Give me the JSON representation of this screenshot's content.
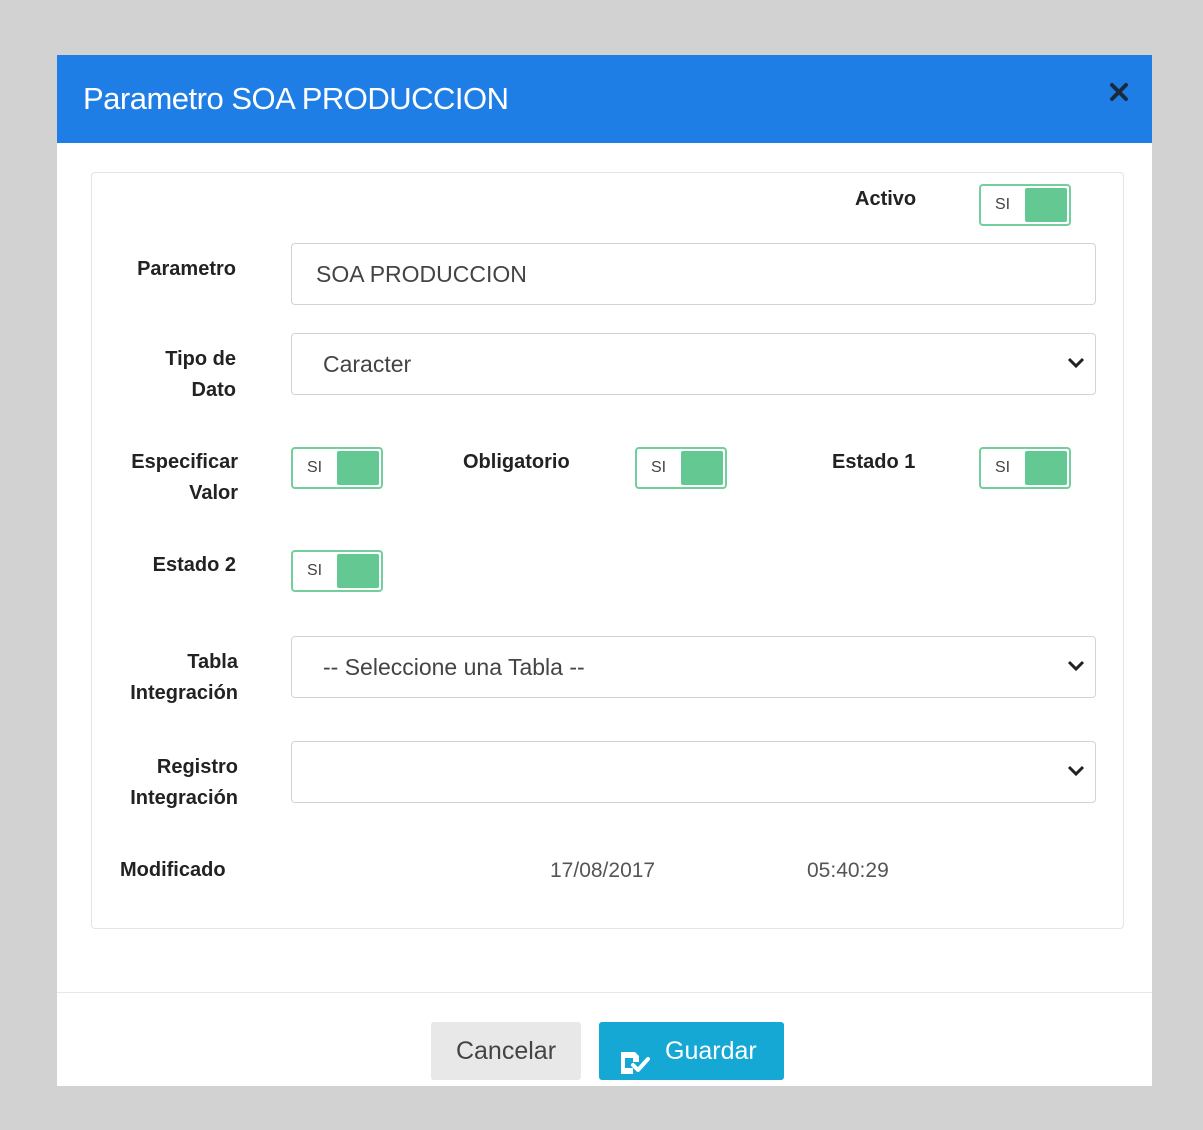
{
  "dialog": {
    "title": "Parametro SOA PRODUCCION",
    "close_icon": "close-icon"
  },
  "form": {
    "activo": {
      "label": "Activo",
      "toggle_text": "SI"
    },
    "parametro": {
      "label": "Parametro",
      "value": "SOA PRODUCCION"
    },
    "tipo_dato": {
      "label_line1": "Tipo de",
      "label_line2": "Dato",
      "selected": "Caracter"
    },
    "especificar_valor": {
      "label_line1": "Especificar",
      "label_line2": "Valor",
      "toggle_text": "SI"
    },
    "obligatorio": {
      "label": "Obligatorio",
      "toggle_text": "SI"
    },
    "estado1": {
      "label": "Estado 1",
      "toggle_text": "SI"
    },
    "estado2": {
      "label": "Estado 2",
      "toggle_text": "SI"
    },
    "tabla_integracion": {
      "label_line1": "Tabla",
      "label_line2": "Integración",
      "selected": "-- Seleccione una Tabla --"
    },
    "registro_integracion": {
      "label_line1": "Registro",
      "label_line2": "Integración",
      "selected": ""
    },
    "modificado": {
      "label": "Modificado",
      "date": "17/08/2017",
      "time": "05:40:29"
    }
  },
  "footer": {
    "cancel_label": "Cancelar",
    "save_label": "Guardar",
    "save_icon": "save-check-icon"
  },
  "colors": {
    "header_bg": "#1e7ee6",
    "toggle_on": "#63c892",
    "save_button": "#15a8d4",
    "page_bg": "#d3d2d2"
  }
}
